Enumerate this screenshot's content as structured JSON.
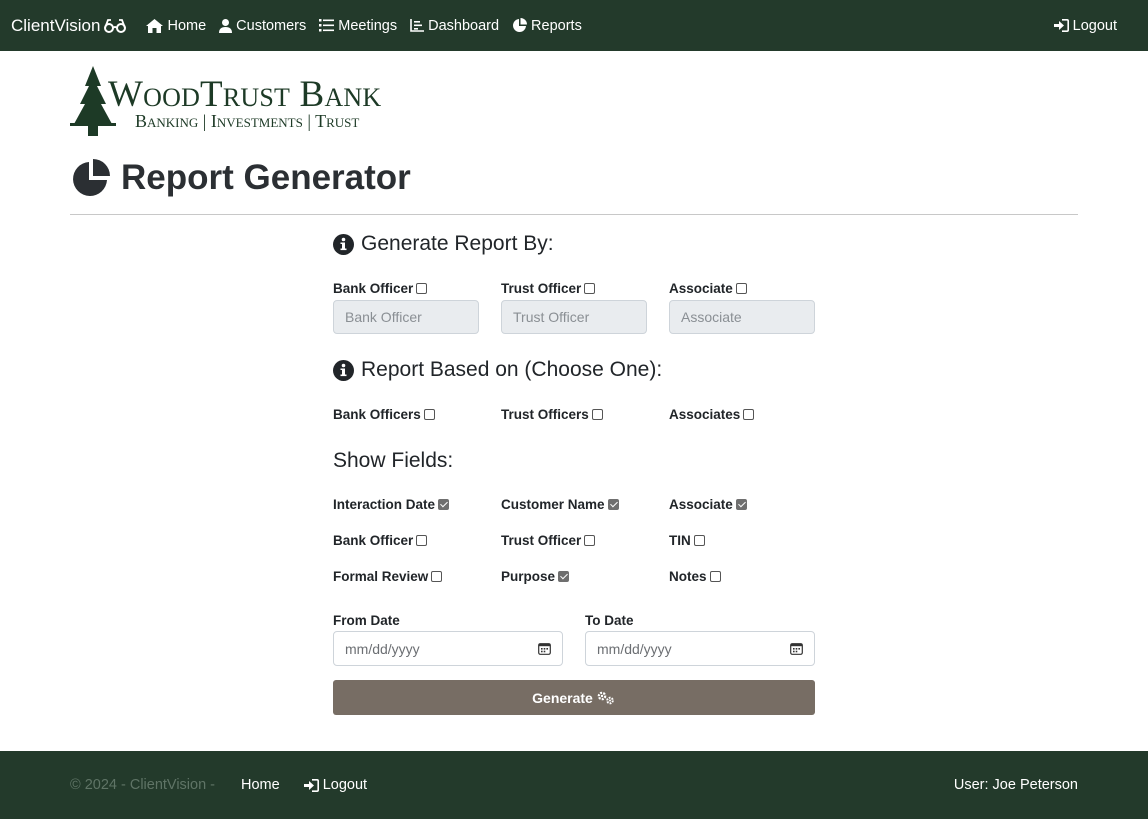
{
  "navbar": {
    "brand": "ClientVision",
    "brand_icon": "glasses-icon",
    "items": [
      {
        "label": "Home",
        "icon": "home-icon"
      },
      {
        "label": "Customers",
        "icon": "user-icon"
      },
      {
        "label": "Meetings",
        "icon": "list-icon"
      },
      {
        "label": "Dashboard",
        "icon": "chart-line-icon"
      },
      {
        "label": "Reports",
        "icon": "chart-pie-icon"
      }
    ],
    "logout": "Logout"
  },
  "logo": {
    "name": "WoodTrust Bank",
    "tagline": "Banking | Investments | Trust"
  },
  "page": {
    "title": "Report Generator"
  },
  "generate_by": {
    "heading": "Generate Report By:",
    "options": [
      {
        "label": "Bank Officer",
        "checked": false,
        "placeholder": "Bank Officer"
      },
      {
        "label": "Trust Officer",
        "checked": false,
        "placeholder": "Trust Officer"
      },
      {
        "label": "Associate",
        "checked": false,
        "placeholder": "Associate"
      }
    ]
  },
  "based_on": {
    "heading": "Report Based on (Choose One):",
    "options": [
      {
        "label": "Bank Officers",
        "checked": false
      },
      {
        "label": "Trust Officers",
        "checked": false
      },
      {
        "label": "Associates",
        "checked": false
      }
    ]
  },
  "show_fields": {
    "heading": "Show Fields:",
    "fields": [
      {
        "label": "Interaction Date",
        "checked": true
      },
      {
        "label": "Customer Name",
        "checked": true
      },
      {
        "label": "Associate",
        "checked": true
      },
      {
        "label": "Bank Officer",
        "checked": false
      },
      {
        "label": "Trust Officer",
        "checked": false
      },
      {
        "label": "TIN",
        "checked": false
      },
      {
        "label": "Formal Review",
        "checked": false
      },
      {
        "label": "Purpose",
        "checked": true
      },
      {
        "label": "Notes",
        "checked": false
      }
    ]
  },
  "dates": {
    "from_label": "From Date",
    "from_placeholder": "mm/dd/yyyy",
    "to_label": "To Date",
    "to_placeholder": "mm/dd/yyyy"
  },
  "generate_button": "Generate",
  "footer": {
    "copyright": "© 2024 - ClientVision -",
    "home": "Home",
    "logout": "Logout",
    "user": "User: Joe Peterson"
  },
  "colors": {
    "navbar_bg": "#233a2b",
    "button_bg": "#776d64",
    "logo_green": "#1d3a26"
  }
}
